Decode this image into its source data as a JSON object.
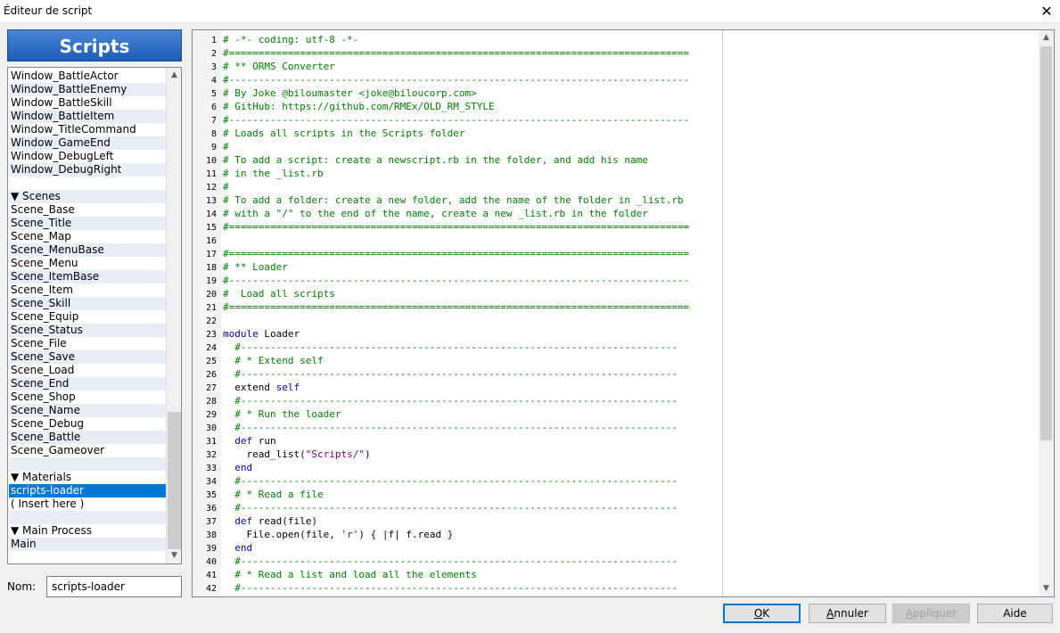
{
  "window": {
    "title": "Éditeur de script",
    "close_glyph": "✕"
  },
  "sidebar": {
    "header": "Scripts",
    "items": [
      "Window_BattleActor",
      "Window_BattleEnemy",
      "Window_BattleSkill",
      "Window_BattleItem",
      "Window_TitleCommand",
      "Window_GameEnd",
      "Window_DebugLeft",
      "Window_DebugRight",
      "",
      "▼ Scenes",
      "Scene_Base",
      "Scene_Title",
      "Scene_Map",
      "Scene_MenuBase",
      "Scene_Menu",
      "Scene_ItemBase",
      "Scene_Item",
      "Scene_Skill",
      "Scene_Equip",
      "Scene_Status",
      "Scene_File",
      "Scene_Save",
      "Scene_Load",
      "Scene_End",
      "Scene_Shop",
      "Scene_Name",
      "Scene_Debug",
      "Scene_Battle",
      "Scene_Gameover",
      "",
      "▼ Materials",
      "scripts-loader",
      "( Insert here )",
      "",
      "▼ Main Process",
      "Main"
    ],
    "selected_index": 31,
    "scroll_up": "▲",
    "scroll_down": "▼"
  },
  "name_field": {
    "label": "Nom:",
    "value": "scripts-loader"
  },
  "editor": {
    "scroll_up": "▲",
    "scroll_down": "▼",
    "lines": [
      [
        [
          "c",
          "# -*- coding: utf-8 -*-"
        ]
      ],
      [
        [
          "c",
          "#=============================================================================="
        ]
      ],
      [
        [
          "c",
          "# ** ORMS Converter"
        ]
      ],
      [
        [
          "c",
          "#------------------------------------------------------------------------------"
        ]
      ],
      [
        [
          "c",
          "# By Joke @biloumaster <joke@biloucorp.com>"
        ]
      ],
      [
        [
          "c",
          "# GitHub: https://github.com/RMEx/OLD_RM_STYLE"
        ]
      ],
      [
        [
          "c",
          "#------------------------------------------------------------------------------"
        ]
      ],
      [
        [
          "c",
          "# Loads all scripts in the Scripts folder"
        ]
      ],
      [
        [
          "c",
          "#"
        ]
      ],
      [
        [
          "c",
          "# To add a script: create a newscript.rb in the folder, and add his name"
        ]
      ],
      [
        [
          "c",
          "# in the _list.rb"
        ]
      ],
      [
        [
          "c",
          "#"
        ]
      ],
      [
        [
          "c",
          "# To add a folder: create a new folder, add the name of the folder in _list.rb"
        ]
      ],
      [
        [
          "c",
          "# with a \"/\" to the end of the name, create a new _list.rb in the folder"
        ]
      ],
      [
        [
          "c",
          "#=============================================================================="
        ]
      ],
      [],
      [
        [
          "c",
          "#=============================================================================="
        ]
      ],
      [
        [
          "c",
          "# ** Loader"
        ]
      ],
      [
        [
          "c",
          "#------------------------------------------------------------------------------"
        ]
      ],
      [
        [
          "c",
          "#  Load all scripts"
        ]
      ],
      [
        [
          "c",
          "#=============================================================================="
        ]
      ],
      [],
      [
        [
          "k",
          "module"
        ],
        [
          "t",
          " Loader"
        ]
      ],
      [
        [
          "c",
          "  #--------------------------------------------------------------------------"
        ]
      ],
      [
        [
          "c",
          "  # * Extend self"
        ]
      ],
      [
        [
          "c",
          "  #--------------------------------------------------------------------------"
        ]
      ],
      [
        [
          "t",
          "  extend "
        ],
        [
          "k",
          "self"
        ]
      ],
      [
        [
          "c",
          "  #--------------------------------------------------------------------------"
        ]
      ],
      [
        [
          "c",
          "  # * Run the loader"
        ]
      ],
      [
        [
          "c",
          "  #--------------------------------------------------------------------------"
        ]
      ],
      [
        [
          "k",
          "  def"
        ],
        [
          "t",
          " run"
        ]
      ],
      [
        [
          "t",
          "    read_list"
        ],
        [
          "p",
          "("
        ],
        [
          "s",
          "\"Scripts/\""
        ],
        [
          "p",
          ")"
        ]
      ],
      [
        [
          "k",
          "  end"
        ]
      ],
      [
        [
          "c",
          "  #--------------------------------------------------------------------------"
        ]
      ],
      [
        [
          "c",
          "  # * Read a file"
        ]
      ],
      [
        [
          "c",
          "  #--------------------------------------------------------------------------"
        ]
      ],
      [
        [
          "k",
          "  def"
        ],
        [
          "t",
          " read"
        ],
        [
          "p",
          "("
        ],
        [
          "t",
          "file"
        ],
        [
          "p",
          ")"
        ]
      ],
      [
        [
          "t",
          "    File.open"
        ],
        [
          "p",
          "("
        ],
        [
          "t",
          "file, "
        ],
        [
          "s",
          "'r'"
        ],
        [
          "p",
          ")"
        ],
        [
          "t",
          " "
        ],
        [
          "p",
          "{"
        ],
        [
          "t",
          " "
        ],
        [
          "p",
          "|"
        ],
        [
          "t",
          "f"
        ],
        [
          "p",
          "|"
        ],
        [
          "t",
          " f.read "
        ],
        [
          "p",
          "}"
        ]
      ],
      [
        [
          "k",
          "  end"
        ]
      ],
      [
        [
          "c",
          "  #--------------------------------------------------------------------------"
        ]
      ],
      [
        [
          "c",
          "  # * Read a list and load all the elements"
        ]
      ],
      [
        [
          "c",
          "  #--------------------------------------------------------------------------"
        ]
      ]
    ]
  },
  "buttons": {
    "ok": {
      "pre": "",
      "u": "O",
      "post": "K"
    },
    "cancel": {
      "pre": "",
      "u": "A",
      "post": "nnuler"
    },
    "apply": {
      "pre": "",
      "u": "A",
      "post": "ppliquer"
    },
    "help": {
      "pre": "Aide",
      "u": "",
      "post": ""
    }
  }
}
